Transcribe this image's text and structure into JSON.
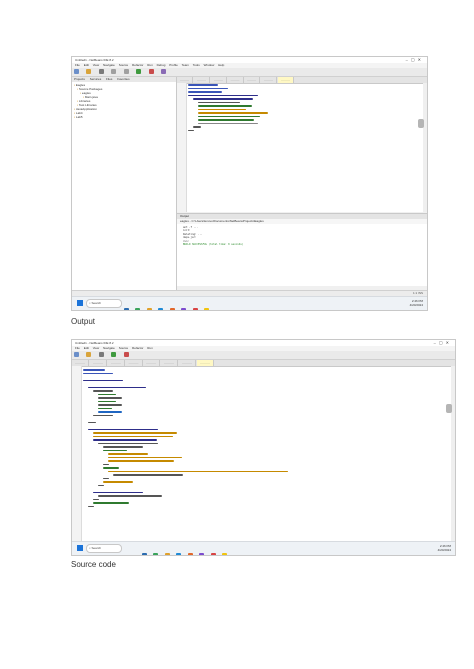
{
  "captions": {
    "first": "Output",
    "second": "Source code"
  },
  "ide": {
    "title": "Untitled1 - NetBeans IDE 8.2",
    "menu": [
      "File",
      "Edit",
      "View",
      "Navigate",
      "Source",
      "Refactor",
      "Run",
      "Debug",
      "Profile",
      "Team",
      "Tools",
      "Window",
      "Help"
    ],
    "panel_tabs": [
      "Projects",
      "Services",
      "Files",
      "Favorites"
    ],
    "project_tree": [
      "Eagles",
      "Source Packages",
      "eagles",
      "Main.java",
      "Libraries",
      "Test Libraries",
      "JavaApplication",
      "Lab4",
      "Lab5"
    ],
    "output_title": "Output",
    "output_crumbs": "eagles - C:\\Users\\lenovo\\Documents\\NetBeansProjects\\Eagles",
    "output_lines": [
      "ant -f ...",
      "init:",
      "Deleting: ...",
      "deps-jar:",
      "run:",
      "BUILD SUCCESSFUL (total time: 0 seconds)"
    ],
    "status_pos": "1:1  INS",
    "taskbar": {
      "search": "Search",
      "time": "2:46 PM",
      "date": "4/20/2024"
    }
  },
  "colors": {
    "accent": "#1a73d9",
    "highlight": "#fff8c4"
  }
}
